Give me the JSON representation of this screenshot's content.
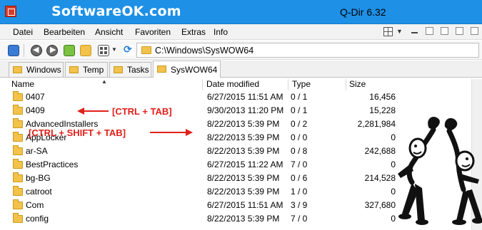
{
  "titlebar": {
    "brand": "SoftwareOK.com",
    "window_title": "Q-Dir 6.32"
  },
  "menu": {
    "items": [
      "Datei",
      "Bearbeiten",
      "Ansicht",
      "Favoriten",
      "Extras",
      "Info"
    ]
  },
  "toolbar": {
    "address": "C:\\Windows\\SysWOW64"
  },
  "tabs": [
    {
      "label": "Windows"
    },
    {
      "label": "Temp"
    },
    {
      "label": "Tasks"
    },
    {
      "label": "SysWOW64",
      "active": true
    }
  ],
  "columns": [
    "Name",
    "Date modified",
    "Type",
    "Size"
  ],
  "rows": [
    {
      "name": "0407",
      "date": "6/27/2015 11:51 AM",
      "type": "0 / 1",
      "size": "16,456"
    },
    {
      "name": "0409",
      "date": "9/30/2013 11:20 PM",
      "type": "0 / 1",
      "size": "15,228"
    },
    {
      "name": "AdvancedInstallers",
      "date": "8/22/2013 5:39 PM",
      "type": "0 / 2",
      "size": "2,281,984"
    },
    {
      "name": "AppLocker",
      "date": "8/22/2013 5:39 PM",
      "type": "0 / 0",
      "size": "0"
    },
    {
      "name": "ar-SA",
      "date": "8/22/2013 5:39 PM",
      "type": "0 / 8",
      "size": "242,688"
    },
    {
      "name": "BestPractices",
      "date": "6/27/2015 11:22 AM",
      "type": "7 / 0",
      "size": "0"
    },
    {
      "name": "bg-BG",
      "date": "8/22/2013 5:39 PM",
      "type": "0 / 6",
      "size": "214,528"
    },
    {
      "name": "catroot",
      "date": "8/22/2013 5:39 PM",
      "type": "1 / 0",
      "size": "0"
    },
    {
      "name": "Com",
      "date": "6/27/2015 11:51 AM",
      "type": "3 / 9",
      "size": "327,680"
    },
    {
      "name": "config",
      "date": "8/22/2013 5:39 PM",
      "type": "7 / 0",
      "size": "0"
    }
  ],
  "annotations": {
    "ctrl_tab": "[CTRL + TAB]",
    "ctrl_shift_tab": "[CTRL + SHIFT + TAB]"
  },
  "colors": {
    "titlebar": "#1e90e6",
    "annotation": "#e0201a",
    "folder": "#f2c24b"
  }
}
